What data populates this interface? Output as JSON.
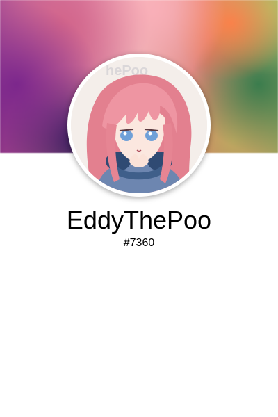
{
  "profile": {
    "username": "EddyThePoo",
    "discriminator": "#7360",
    "avatar_watermark": "EddyThePoo"
  },
  "colors": {
    "background": "#ffffff",
    "text": "#000000",
    "avatar_ring": "#ffffff",
    "hair": "#e88a96",
    "eyes": "#6fa0d8",
    "headphones": "#3f5f8a"
  },
  "icons": {
    "avatar": "anime-character-avatar"
  }
}
